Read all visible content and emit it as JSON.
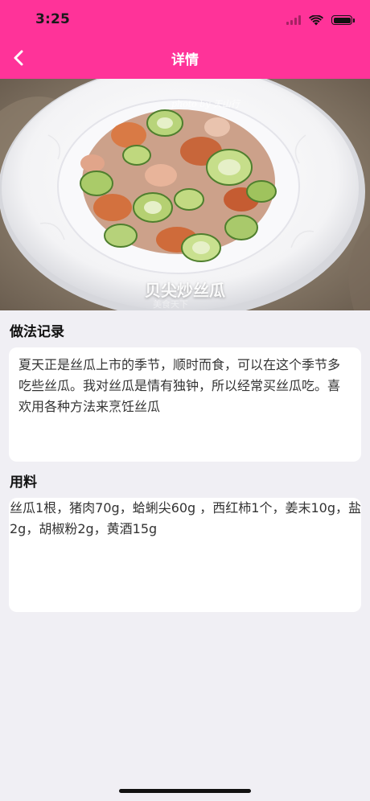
{
  "status_bar": {
    "time": "3:25"
  },
  "nav": {
    "title": "详情",
    "back_icon": "chevron-left-icon"
  },
  "hero": {
    "caption": "贝尖炒丝瓜",
    "watermark": "photo by 天山行",
    "watermark_small": "美食天下"
  },
  "method": {
    "title": "做法记录",
    "text": "夏天正是丝瓜上市的季节，顺时而食，可以在这个季节多吃些丝瓜。我对丝瓜是情有独钟，所以经常买丝瓜吃。喜欢用各种方法来烹饪丝瓜"
  },
  "ingredients": {
    "title": "用料",
    "text": "丝瓜1根，猪肉70g，蛤蜊尖60g ，西红柿1个，姜末10g，盐2g，胡椒粉2g，黄酒15g"
  },
  "colors": {
    "accent": "#FF3399",
    "background": "#F0EFF4",
    "card": "#FFFFFF"
  }
}
